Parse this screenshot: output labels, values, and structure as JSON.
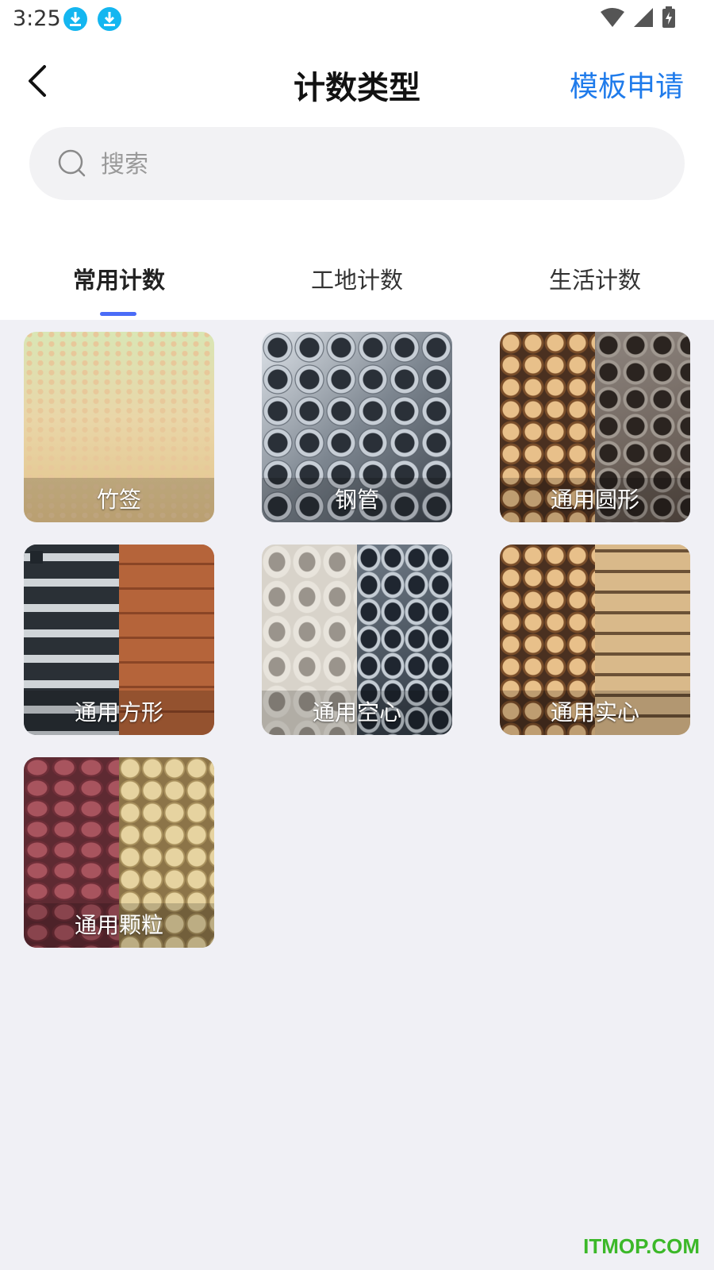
{
  "status_bar": {
    "time": "3:25"
  },
  "header": {
    "title": "计数类型",
    "apply_label": "模板申请"
  },
  "search": {
    "placeholder": "搜索",
    "value": ""
  },
  "tabs": [
    {
      "label": "常用计数",
      "active": true
    },
    {
      "label": "工地计数",
      "active": false
    },
    {
      "label": "生活计数",
      "active": false
    }
  ],
  "cards": [
    {
      "label": "竹签"
    },
    {
      "label": "钢管"
    },
    {
      "label": "通用圆形"
    },
    {
      "label": "通用方形"
    },
    {
      "label": "通用空心"
    },
    {
      "label": "通用实心"
    },
    {
      "label": "通用颗粒"
    }
  ],
  "colors": {
    "accent": "#1F7BEB",
    "tab_indicator": "#4A6CF7",
    "page_bg": "#F0F0F5"
  },
  "watermark": "ITMOP.COM"
}
